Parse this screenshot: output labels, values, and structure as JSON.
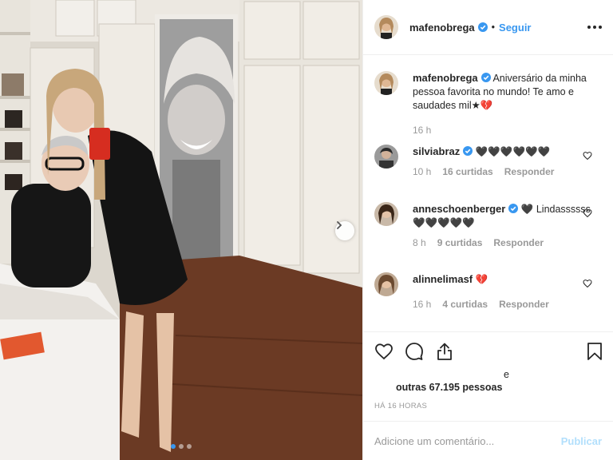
{
  "photo": {
    "alt_subject": "photo",
    "carousel": {
      "total": 3,
      "active": 0
    }
  },
  "header": {
    "username": "mafenobrega",
    "separator": "•",
    "follow_label": "Seguir",
    "more_icon": "more-dots-icon"
  },
  "caption": {
    "username": "mafenobrega",
    "text": "Aniversário da minha pessoa favorita no mundo! Te amo e saudades mil★💔",
    "time": "16 h"
  },
  "comments": [
    {
      "username": "silviabraz",
      "verified": true,
      "text": "🖤🖤🖤🖤🖤🖤",
      "time": "10 h",
      "likes": "16 curtidas",
      "reply": "Responder"
    },
    {
      "username": "anneschoenberger",
      "verified": true,
      "text": "🖤 Lindassssss🖤🖤🖤🖤🖤",
      "time": "8 h",
      "likes": "9 curtidas",
      "reply": "Responder"
    },
    {
      "username": "alinnelimasf",
      "verified": false,
      "text": "💔",
      "time": "16 h",
      "likes": "4 curtidas",
      "reply": "Responder"
    }
  ],
  "likes": {
    "and": "e",
    "others": "outras 67.195 pessoas"
  },
  "posted_ago": "HÁ 16 HORAS",
  "add_comment": {
    "placeholder": "Adicione um comentário...",
    "publish_label": "Publicar"
  },
  "colors": {
    "accent": "#3897f0",
    "muted": "#999999",
    "publish_disabled": "#b2dffc",
    "divider": "#efefef"
  }
}
